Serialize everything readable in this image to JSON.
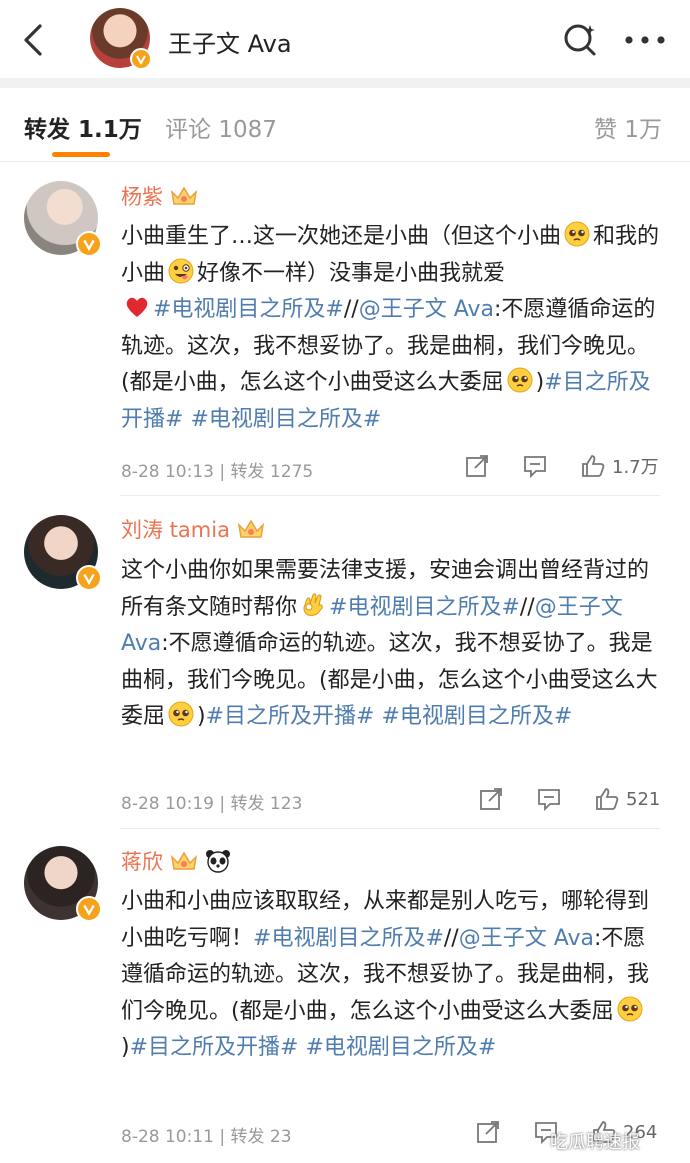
{
  "header": {
    "title": "王子文 Ava"
  },
  "tabs": {
    "repost_label": "转发",
    "repost_count": "1.1万",
    "comment_label": "评论",
    "comment_count": "1087",
    "like_label": "赞",
    "like_count": "1万"
  },
  "items": [
    {
      "name": "杨紫",
      "t1": "小曲重生了…这一次她还是小曲（但这个小曲",
      "t2": "和我的小曲",
      "t3": "好像不一样）没事是小曲我就爱",
      "topic1": "#电视剧目之所及#",
      "sep": "//",
      "mention": "@王子文 Ava",
      "t4": ":不愿遵循命运的轨迹。这次，我不想妥协了。我是曲桐，我们今晚见。(都是小曲，怎么这个小曲受这么大委屈",
      "t5": ")",
      "topic2": "#目之所及开播#",
      "topic3": "#电视剧目之所及#",
      "time": "8-28 10:13",
      "reposts": "转发 1275",
      "likes": "1.7万"
    },
    {
      "name": "刘涛 tamia",
      "t1": "这个小曲你如果需要法律支援，安迪会调出曾经背过的所有条文随时帮你",
      "topic1": "#电视剧目之所及#",
      "sep": "//",
      "mention": "@王子文 Ava",
      "t4": ":不愿遵循命运的轨迹。这次，我不想妥协了。我是曲桐，我们今晚见。(都是小曲，怎么这个小曲受这么大委屈",
      "t5": ")",
      "topic2": "#目之所及开播#",
      "topic3": "#电视剧目之所及#",
      "time": "8-28 10:19",
      "reposts": "转发 123",
      "likes": "521"
    },
    {
      "name": "蒋欣",
      "t1": "小曲和小曲应该取取经，从来都是别人吃亏，哪轮得到小曲吃亏啊！",
      "topic1": "#电视剧目之所及#",
      "sep": "//",
      "mention": "@王子文 Ava",
      "t4": ":不愿遵循命运的轨迹。这次，我不想妥协了。我是曲桐，我们今晚见。(都是小曲，怎么这个小曲受这么大委屈",
      "t5": ")",
      "topic2": "#目之所及开播#",
      "topic3": "#电视剧目之所及#",
      "time": "8-28 10:11",
      "reposts": "转发 23",
      "likes": "264"
    }
  ],
  "watermark": "吃瓜聘速报",
  "colors": {
    "accent": "#ff8200",
    "name": "#eb7350",
    "link": "#507daf",
    "verified": "#f7a21b"
  },
  "icons": [
    "back-icon",
    "search-icon",
    "more-icon",
    "verified-icon",
    "crown-icon",
    "panda-icon",
    "share-icon",
    "comment-icon",
    "like-icon",
    "pleading-face-emoji",
    "zany-face-emoji",
    "heart-emoji",
    "ok-hand-emoji"
  ]
}
